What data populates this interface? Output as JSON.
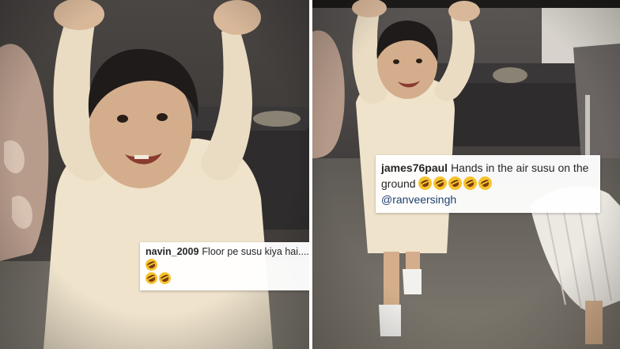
{
  "comments": {
    "left": {
      "username": "navin_2009",
      "text": "Floor pe susu kiya hai....",
      "emoji_name": "rolling-on-floor-laughing-emoji"
    },
    "right": {
      "username": "james76paul",
      "text": "Hands in the air susu on the ground",
      "emoji_name": "rolling-on-floor-laughing-emoji",
      "mention": "@ranveersingh"
    }
  },
  "colors": {
    "sepia_light": "#d8cdb6",
    "sepia_dark": "#3e3a38",
    "comment_bg": "#ffffff",
    "comment_text": "#262626"
  }
}
